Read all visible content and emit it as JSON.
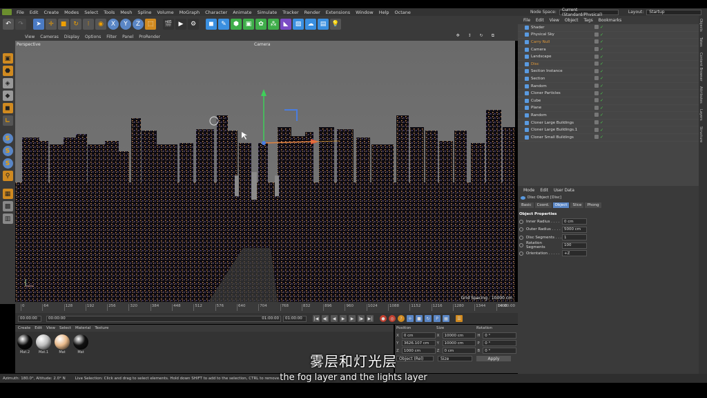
{
  "menubar": {
    "items": [
      "File",
      "Edit",
      "Create",
      "Modes",
      "Select",
      "Tools",
      "Mesh",
      "Spline",
      "Volume",
      "MoGraph",
      "Character",
      "Animate",
      "Simulate",
      "Tracker",
      "Render",
      "Extensions",
      "Window",
      "Help",
      "Octane"
    ],
    "node_space_label": "Node Space:",
    "node_space_value": "Current (Standard/Physical)",
    "layout_label": "Layout:",
    "layout_value": "Startup"
  },
  "viewport": {
    "menu": [
      "View",
      "Cameras",
      "Display",
      "Options",
      "Filter",
      "Panel",
      "ProRender"
    ],
    "view_name": "Perspective",
    "camera_label": "Camera",
    "grid_spacing": "Grid Spacing : 10000 cm"
  },
  "timeline": {
    "ticks": [
      "0",
      "64",
      "128",
      "192",
      "256",
      "320",
      "384",
      "448",
      "512",
      "576",
      "640",
      "704",
      "768",
      "832",
      "896",
      "960",
      "1024",
      "1088",
      "1152",
      "1216",
      "1280",
      "1344",
      "1408"
    ],
    "end_frame": "00:00:00",
    "start_time": "00:00:00",
    "current_time": "00:00:00",
    "range_end": "01:00:00",
    "max_time": "01:00:00"
  },
  "materials": {
    "menu": [
      "Create",
      "Edit",
      "View",
      "Select",
      "Material",
      "Texture"
    ],
    "items": [
      {
        "label": "Mat.2",
        "color": "#0a0a0a"
      },
      {
        "label": "Mat.1",
        "color": "#bdbdbd"
      },
      {
        "label": "Mat",
        "color": "#e8b98a"
      },
      {
        "label": "Mat",
        "color": "#111111"
      }
    ]
  },
  "coordinates": {
    "headers": [
      "Position",
      "Size",
      "Rotation"
    ],
    "rows": [
      {
        "axis": "X",
        "pos": "0 cm",
        "size_axis": "X",
        "size": "10000 cm",
        "rot_axis": "H",
        "rot": "0 °"
      },
      {
        "axis": "Y",
        "pos": "3626.107 cm",
        "size_axis": "Y",
        "size": "10000 cm",
        "rot_axis": "P",
        "rot": "0 °"
      },
      {
        "axis": "Z",
        "pos": "1000 cm",
        "size_axis": "Z",
        "size": "0 cm",
        "rot_axis": "B",
        "rot": "0 °"
      }
    ],
    "mode": "Object (Rel)",
    "size_mode": "Size",
    "apply": "Apply"
  },
  "objects": {
    "menu": [
      "File",
      "Edit",
      "View",
      "Object",
      "Tags",
      "Bookmarks"
    ],
    "rows": [
      {
        "name": "Shader",
        "color": "#ddd"
      },
      {
        "name": "Physical Sky",
        "color": "#ddd"
      },
      {
        "name": "Carry Null",
        "color": "#e29a3a"
      },
      {
        "name": "Camera",
        "color": "#ddd"
      },
      {
        "name": "Landscape",
        "color": "#ddd"
      },
      {
        "name": "Disc",
        "color": "#e29a3a"
      },
      {
        "name": "Section Instance",
        "color": "#ddd"
      },
      {
        "name": "Section",
        "color": "#ddd"
      },
      {
        "name": "Random",
        "color": "#ddd"
      },
      {
        "name": "Cloner Particles",
        "color": "#ddd"
      },
      {
        "name": "Cube",
        "color": "#ddd"
      },
      {
        "name": "Plane",
        "color": "#ddd"
      },
      {
        "name": "Random",
        "color": "#ddd"
      },
      {
        "name": "Cloner Large Buildings",
        "color": "#ddd"
      },
      {
        "name": "Cloner Large Buildings.1",
        "color": "#ddd"
      },
      {
        "name": "Cloner Small Buildings",
        "color": "#ddd"
      }
    ]
  },
  "attributes": {
    "menu": [
      "Mode",
      "Edit",
      "User Data"
    ],
    "object_title": "Disc Object [Disc]",
    "tabs": [
      "Basic",
      "Coord.",
      "Object",
      "Slice",
      "Phong"
    ],
    "active_tab": "Object",
    "section": "Object Properties",
    "props": [
      {
        "label": "Inner Radius . . . .",
        "value": "0 cm"
      },
      {
        "label": "Outer Radius . . . .",
        "value": "5000 cm"
      },
      {
        "label": "Disc Segments . . .",
        "value": "1"
      },
      {
        "label": "Rotation Segments",
        "value": "100"
      },
      {
        "label": "Orientation . . . . .",
        "value": "+Z"
      }
    ]
  },
  "side_tabs": [
    "Objects",
    "Takes",
    "Content Browser",
    "Attributes",
    "Layers",
    "Structure"
  ],
  "status": {
    "azimuth": "Azimuth: 180.0°, Altitude: 2.0° N",
    "message": "Live Selection: Click and drag to select elements. Hold down SHIFT to add to the selection, CTRL to remove."
  },
  "subtitles": {
    "chinese": "雾层和灯光层",
    "english": "the fog layer and the lights layer"
  }
}
